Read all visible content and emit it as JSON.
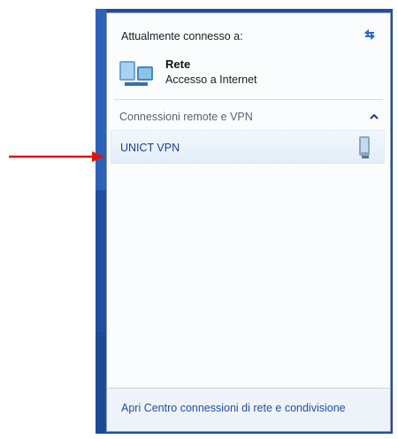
{
  "flyout": {
    "connected_label": "Attualmente connesso a:",
    "network": {
      "name": "Rete",
      "status": "Accesso a Internet"
    },
    "section_label": "Connessioni remote e VPN",
    "vpn_items": [
      {
        "name": "UNICT VPN"
      }
    ],
    "footer_link": "Apri Centro connessioni di rete e condivisione"
  },
  "colors": {
    "desktop": "#1f4f9e",
    "link": "#1f4fa8",
    "annotation_arrow": "#e11414"
  },
  "icons": {
    "refresh": "refresh-icon",
    "network": "network-icon",
    "collapse": "chevron-up-icon",
    "vpn": "vpn-connection-icon"
  }
}
